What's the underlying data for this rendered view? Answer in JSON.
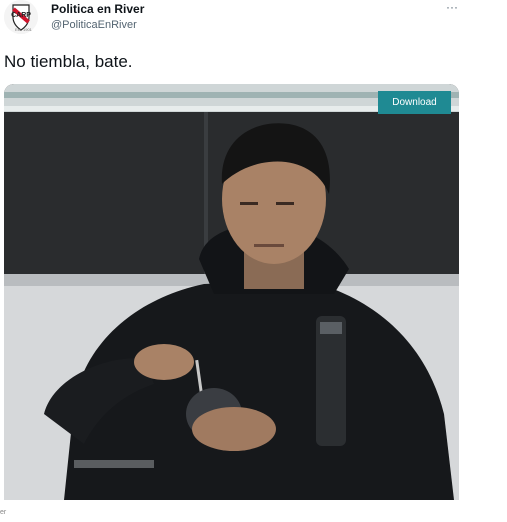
{
  "tweet": {
    "author_name": "Politica en River",
    "author_handle": "@PoliticaEnRiver",
    "avatar_caption": "Est. 1901",
    "more_icon": "more-horizontal-icon",
    "text": "No tiembla, bate."
  },
  "media": {
    "download_label": "Download"
  },
  "footer": {
    "fragment": "er"
  },
  "colors": {
    "download_button": "#1f8a93",
    "handle_gray": "#536471",
    "text_dark": "#0f1419"
  }
}
